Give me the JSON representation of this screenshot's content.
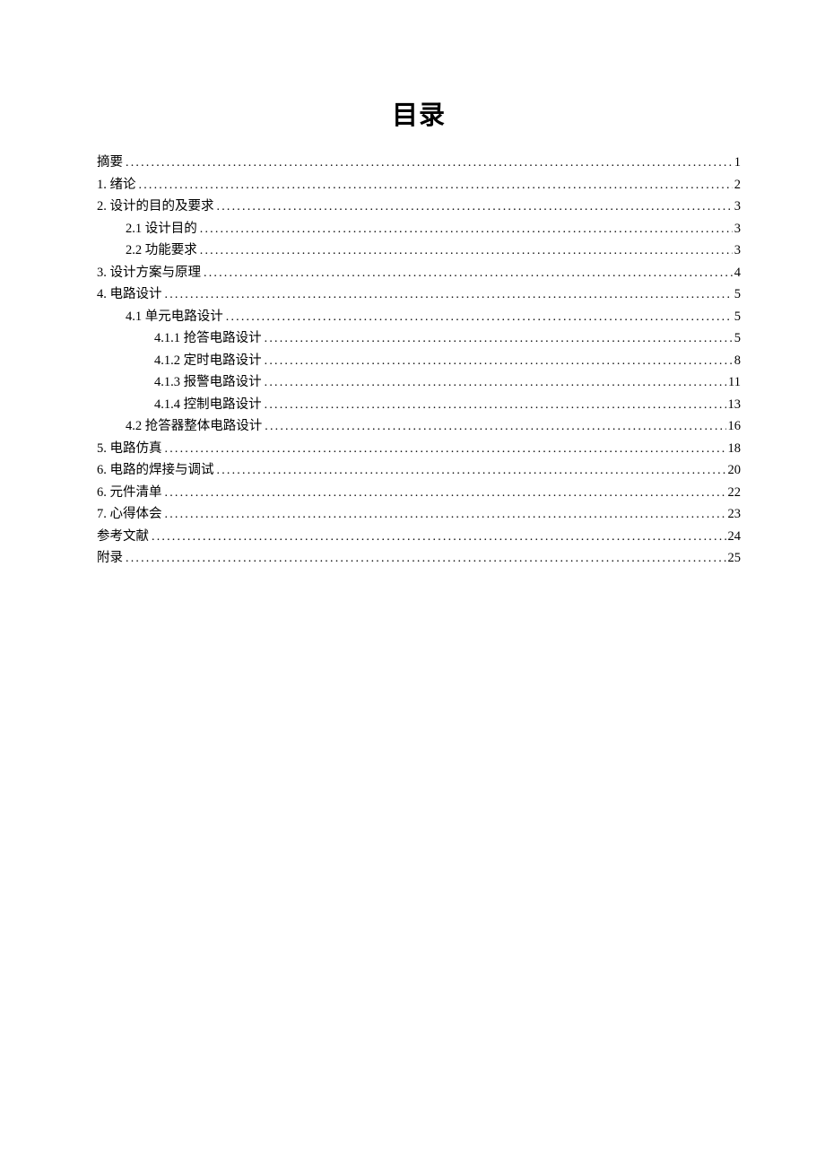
{
  "title": "目录",
  "entries": [
    {
      "label": "摘要",
      "page": "1",
      "indent": 0
    },
    {
      "label": "1. 绪论",
      "page": "2",
      "indent": 0
    },
    {
      "label": "2. 设计的目的及要求",
      "page": "3",
      "indent": 0
    },
    {
      "label": "2.1 设计目的",
      "page": "3",
      "indent": 1
    },
    {
      "label": "2.2 功能要求",
      "page": "3",
      "indent": 1
    },
    {
      "label": "3. 设计方案与原理",
      "page": "4",
      "indent": 0
    },
    {
      "label": "4. 电路设计",
      "page": "5",
      "indent": 0
    },
    {
      "label": "4.1 单元电路设计",
      "page": "5",
      "indent": 1
    },
    {
      "label": "4.1.1 抢答电路设计",
      "page": "5",
      "indent": 2
    },
    {
      "label": "4.1.2 定时电路设计",
      "page": "8",
      "indent": 2
    },
    {
      "label": "4.1.3 报警电路设计",
      "page": "11",
      "indent": 2
    },
    {
      "label": "4.1.4 控制电路设计",
      "page": "13",
      "indent": 2
    },
    {
      "label": "4.2 抢答器整体电路设计",
      "page": "16",
      "indent": 1
    },
    {
      "label": "5. 电路仿真",
      "page": "18",
      "indent": 0
    },
    {
      "label": "6. 电路的焊接与调试",
      "page": "20",
      "indent": 0
    },
    {
      "label": "6. 元件清单",
      "page": "22",
      "indent": 0
    },
    {
      "label": "7. 心得体会",
      "page": "23",
      "indent": 0
    },
    {
      "label": "参考文献",
      "page": "24",
      "indent": 0
    },
    {
      "label": "附录",
      "page": "25",
      "indent": 0
    }
  ]
}
